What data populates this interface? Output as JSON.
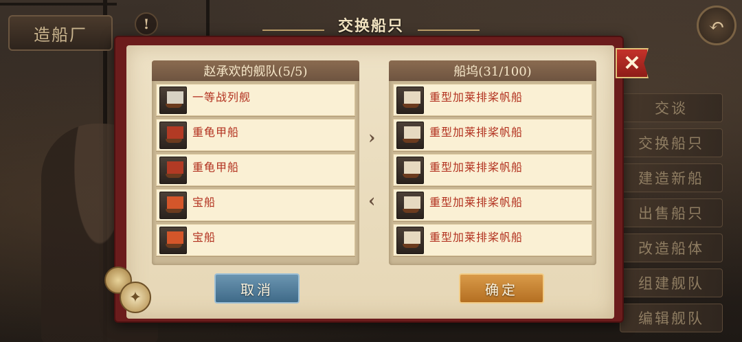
{
  "background": {
    "top_button_label": "造船厂",
    "warn_glyph": "!",
    "back_glyph": "↶",
    "side_menu": [
      "交谈",
      "交换船只",
      "建造新船",
      "出售船只",
      "改造船体",
      "组建舰队",
      "编辑舰队"
    ]
  },
  "dialog": {
    "title": "交换船只",
    "close_glyph": "✕",
    "fleet": {
      "header": "赵承欢的舰队(5/5)",
      "ships": [
        {
          "name": "一等战列舰",
          "icon": "ship-of-the-line-icon",
          "sail_color": "#d8d2c4"
        },
        {
          "name": "重龟甲船",
          "icon": "turtle-ship-icon",
          "sail_color": "#b23a24"
        },
        {
          "name": "重龟甲船",
          "icon": "turtle-ship-icon",
          "sail_color": "#b23a24"
        },
        {
          "name": "宝船",
          "icon": "treasure-ship-icon",
          "sail_color": "#d4562a"
        },
        {
          "name": "宝船",
          "icon": "treasure-ship-icon",
          "sail_color": "#d4562a"
        }
      ]
    },
    "dock": {
      "header": "船坞(31/100)",
      "ships": [
        {
          "name": "重型加莱排桨帆船",
          "icon": "galleass-icon",
          "sail_color": "#e6d9c0"
        },
        {
          "name": "重型加莱排桨帆船",
          "icon": "galleass-icon",
          "sail_color": "#e6d9c0"
        },
        {
          "name": "重型加莱排桨帆船",
          "icon": "galleass-icon",
          "sail_color": "#e6d9c0"
        },
        {
          "name": "重型加莱排桨帆船",
          "icon": "galleass-icon",
          "sail_color": "#e6d9c0"
        },
        {
          "name": "重型加莱排桨帆船",
          "icon": "galleass-icon",
          "sail_color": "#e6d9c0"
        }
      ]
    },
    "arrow_right": "›",
    "arrow_left": "‹",
    "cancel_label": "取消",
    "confirm_label": "确定"
  },
  "colors": {
    "ship_name": "#b2311f",
    "dialog_frame": "#6b1c1c",
    "cancel_button": "#4f7c9c",
    "confirm_button": "#c7842f"
  }
}
